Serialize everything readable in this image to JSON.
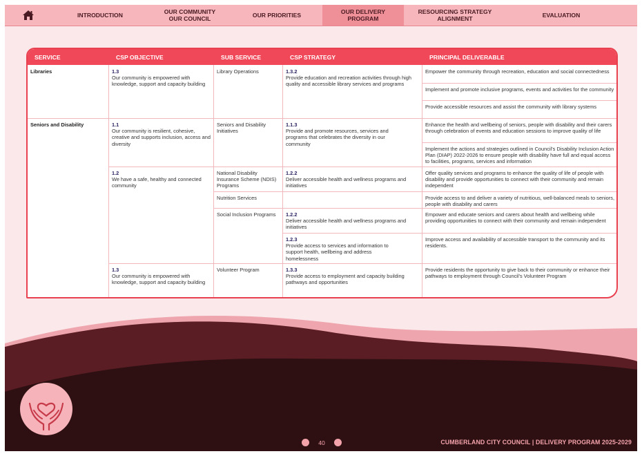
{
  "nav": {
    "items": [
      {
        "label": "INTRODUCTION"
      },
      {
        "label": "OUR COMMUNITY\nOUR COUNCIL"
      },
      {
        "label": "OUR PRIORITIES"
      },
      {
        "label": "OUR DELIVERY\nPROGRAM"
      },
      {
        "label": "RESOURCING STRATEGY\nALIGNMENT"
      },
      {
        "label": "EVALUATION"
      }
    ],
    "active_index": 3
  },
  "table": {
    "headers": [
      "SERVICE",
      "CSP OBJECTIVE",
      "SUB SERVICE",
      "CSP STRATEGY",
      "PRINCIPAL DELIVERABLE"
    ],
    "services": [
      "Libraries",
      "Seniors and Disability"
    ],
    "objectives": [
      {
        "num": "1.3",
        "text": "Our community is empowered with knowledge, support and capacity building"
      },
      {
        "num": "1.1",
        "text": "Our community is resilient, cohesive, creative and supports inclusion, access and diversity"
      },
      {
        "num": "1.2",
        "text": "We have a safe, healthy and connected community"
      },
      {
        "num": "1.3",
        "text": "Our community is empowered with knowledge, support and capacity building"
      }
    ],
    "sub_services": [
      "Library Operations",
      "Seniors and Disability Initiatives",
      "National Disability Insurance Scheme (NDIS) Programs",
      "Nutrition Services",
      "Social Inclusion Programs",
      "Volunteer Program"
    ],
    "strategies": [
      {
        "num": "1.3.2",
        "text": "Provide education and recreation activities through high quality and accessible library services and programs"
      },
      {
        "num": "1.1.3",
        "text": "Provide and promote resources, services and programs that celebrates the diversity in our community"
      },
      {
        "num": "1.2.2",
        "text": "Deliver accessible health and wellness programs and initiatives"
      },
      {
        "num": "1.2.2",
        "text": "Deliver accessible health and wellness programs and initiatives"
      },
      {
        "num": "1.2.3",
        "text": "Provide access to services and information to support health, wellbeing and address homelessness"
      },
      {
        "num": "1.3.3",
        "text": "Provide access to employment and capacity building pathways and opportunities"
      }
    ],
    "deliverables": [
      "Empower the community through recreation, education and social connectedness",
      "Implement and promote inclusive programs, events and activities for the community",
      "Provide accessible resources and assist the community with library systems",
      "Enhance the health and wellbeing of seniors, people with disability and their carers through celebration of events and education sessions to improve quality of life",
      "Implement the actions and strategies outlined in Council's Disability Inclusion Action Plan (DIAP) 2022-2026 to ensure people with disability have full and equal access to facilities, programs, services and information",
      "Offer quality services and programs to enhance the quality of life of people with disability and provide opportunities to connect with their community and remain independent",
      "Provide access to and deliver a variety of nutritious, well-balanced meals to seniors, people with disability and carers",
      "Empower and educate seniors and carers about health and wellbeing while providing opportunities to connect with their community and remain independent",
      "Improve access and availability of accessible transport to the community and its residents.",
      "Provide residents the opportunity to give back to their community or enhance their pathways to employment through Council's Volunteer Program"
    ]
  },
  "footer": {
    "page_number": "40",
    "title": "CUMBERLAND CITY COUNCIL  |  DELIVERY PROGRAM 2025-2029"
  },
  "colors": {
    "header_red": "#f04858",
    "nav_pink": "#f6b6bc",
    "nav_active": "#ef8f98",
    "dark_wave": "#3a1418",
    "accent_pink": "#f4a3ab"
  }
}
